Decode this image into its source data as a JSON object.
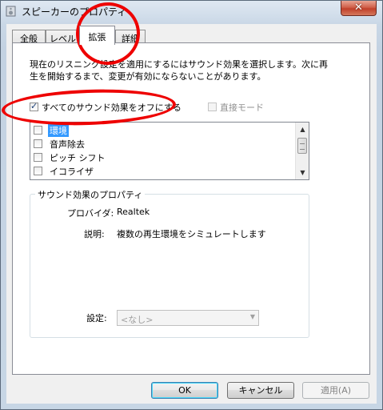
{
  "window": {
    "title": "スピーカーのプロパティ",
    "close_label": "✕"
  },
  "tabs": [
    {
      "label": "全般"
    },
    {
      "label": "レベル"
    },
    {
      "label": "拡張",
      "selected": true
    },
    {
      "label": "詳細"
    }
  ],
  "description": {
    "line1": "現在のリスニング設定を適用にするにはサウンド効果を選択します。次に再",
    "line2": "生を開始するまで、変更が有効にならないことがあります。"
  },
  "disable_all": {
    "label": "すべてのサウンド効果をオフにする",
    "checked": true
  },
  "direct_mode": {
    "label": "直接モード",
    "checked": false,
    "enabled": false
  },
  "effects": [
    {
      "label": "環境",
      "checked": false,
      "selected": true
    },
    {
      "label": "音声除去",
      "checked": false
    },
    {
      "label": "ピッチ シフト",
      "checked": false
    },
    {
      "label": "イコライザ",
      "checked": false
    }
  ],
  "properties": {
    "group_title": "サウンド効果のプロパティ",
    "provider_label": "プロバイダ:",
    "provider_value": "Realtek",
    "desc_label": "説明:",
    "desc_value": "複数の再生環境をシミュレートします",
    "setting_label": "設定:",
    "setting_value": "<なし>"
  },
  "buttons": {
    "ok": "OK",
    "cancel": "キャンセル",
    "apply": "適用(A)"
  },
  "colors": {
    "annotation": "#ee0000",
    "selection": "#3399ff"
  }
}
